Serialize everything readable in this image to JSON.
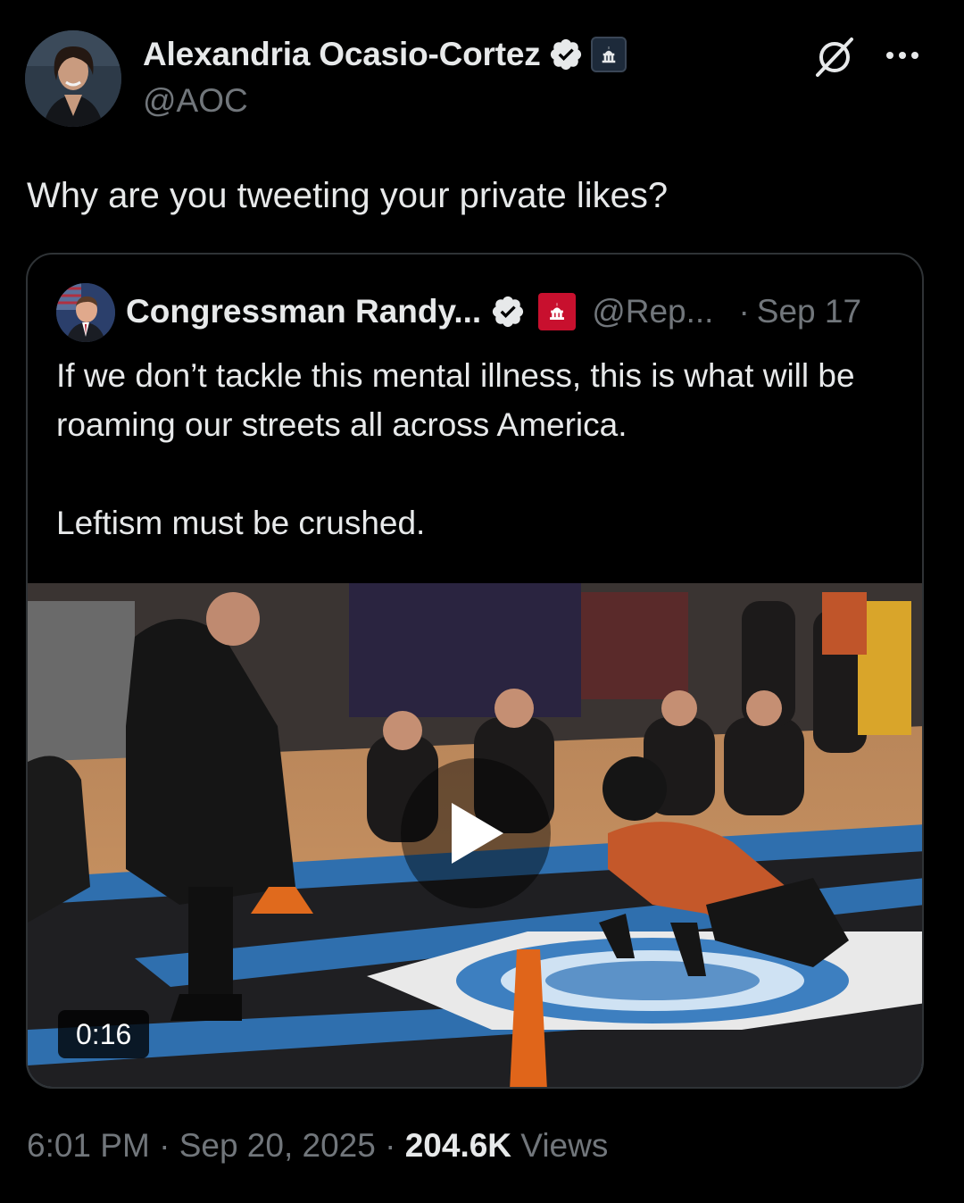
{
  "author": {
    "display_name": "Alexandria Ocasio-Cortez",
    "handle": "@AOC",
    "verified_icon": "verified-badge-icon",
    "affiliation_icon": "capitol-building-icon"
  },
  "header_actions": {
    "grok_icon": "grok-slash-icon",
    "more_icon": "more-dots-icon"
  },
  "tweet": {
    "text": "Why are you tweeting your private likes?"
  },
  "quoted": {
    "display_name": "Congressman Randy...",
    "handle": "@Rep...",
    "separator": "·",
    "date": "Sep 17",
    "text": "If we don’t tackle this mental illness, this is what will be roaming our streets all across America.\n\nLeftism must be crushed.",
    "media": {
      "duration": "0:16",
      "play_icon": "play-icon"
    }
  },
  "meta": {
    "time": "6:01 PM",
    "dot1": " · ",
    "date": "Sep 20, 2025",
    "dot2": " · ",
    "views_count": "204.6K",
    "views_label": " Views"
  },
  "colors": {
    "background": "#000000",
    "text_primary": "#e7e9ea",
    "text_secondary": "#71767b",
    "border": "#2f3336",
    "verified_blue": "#1d9bf0"
  }
}
